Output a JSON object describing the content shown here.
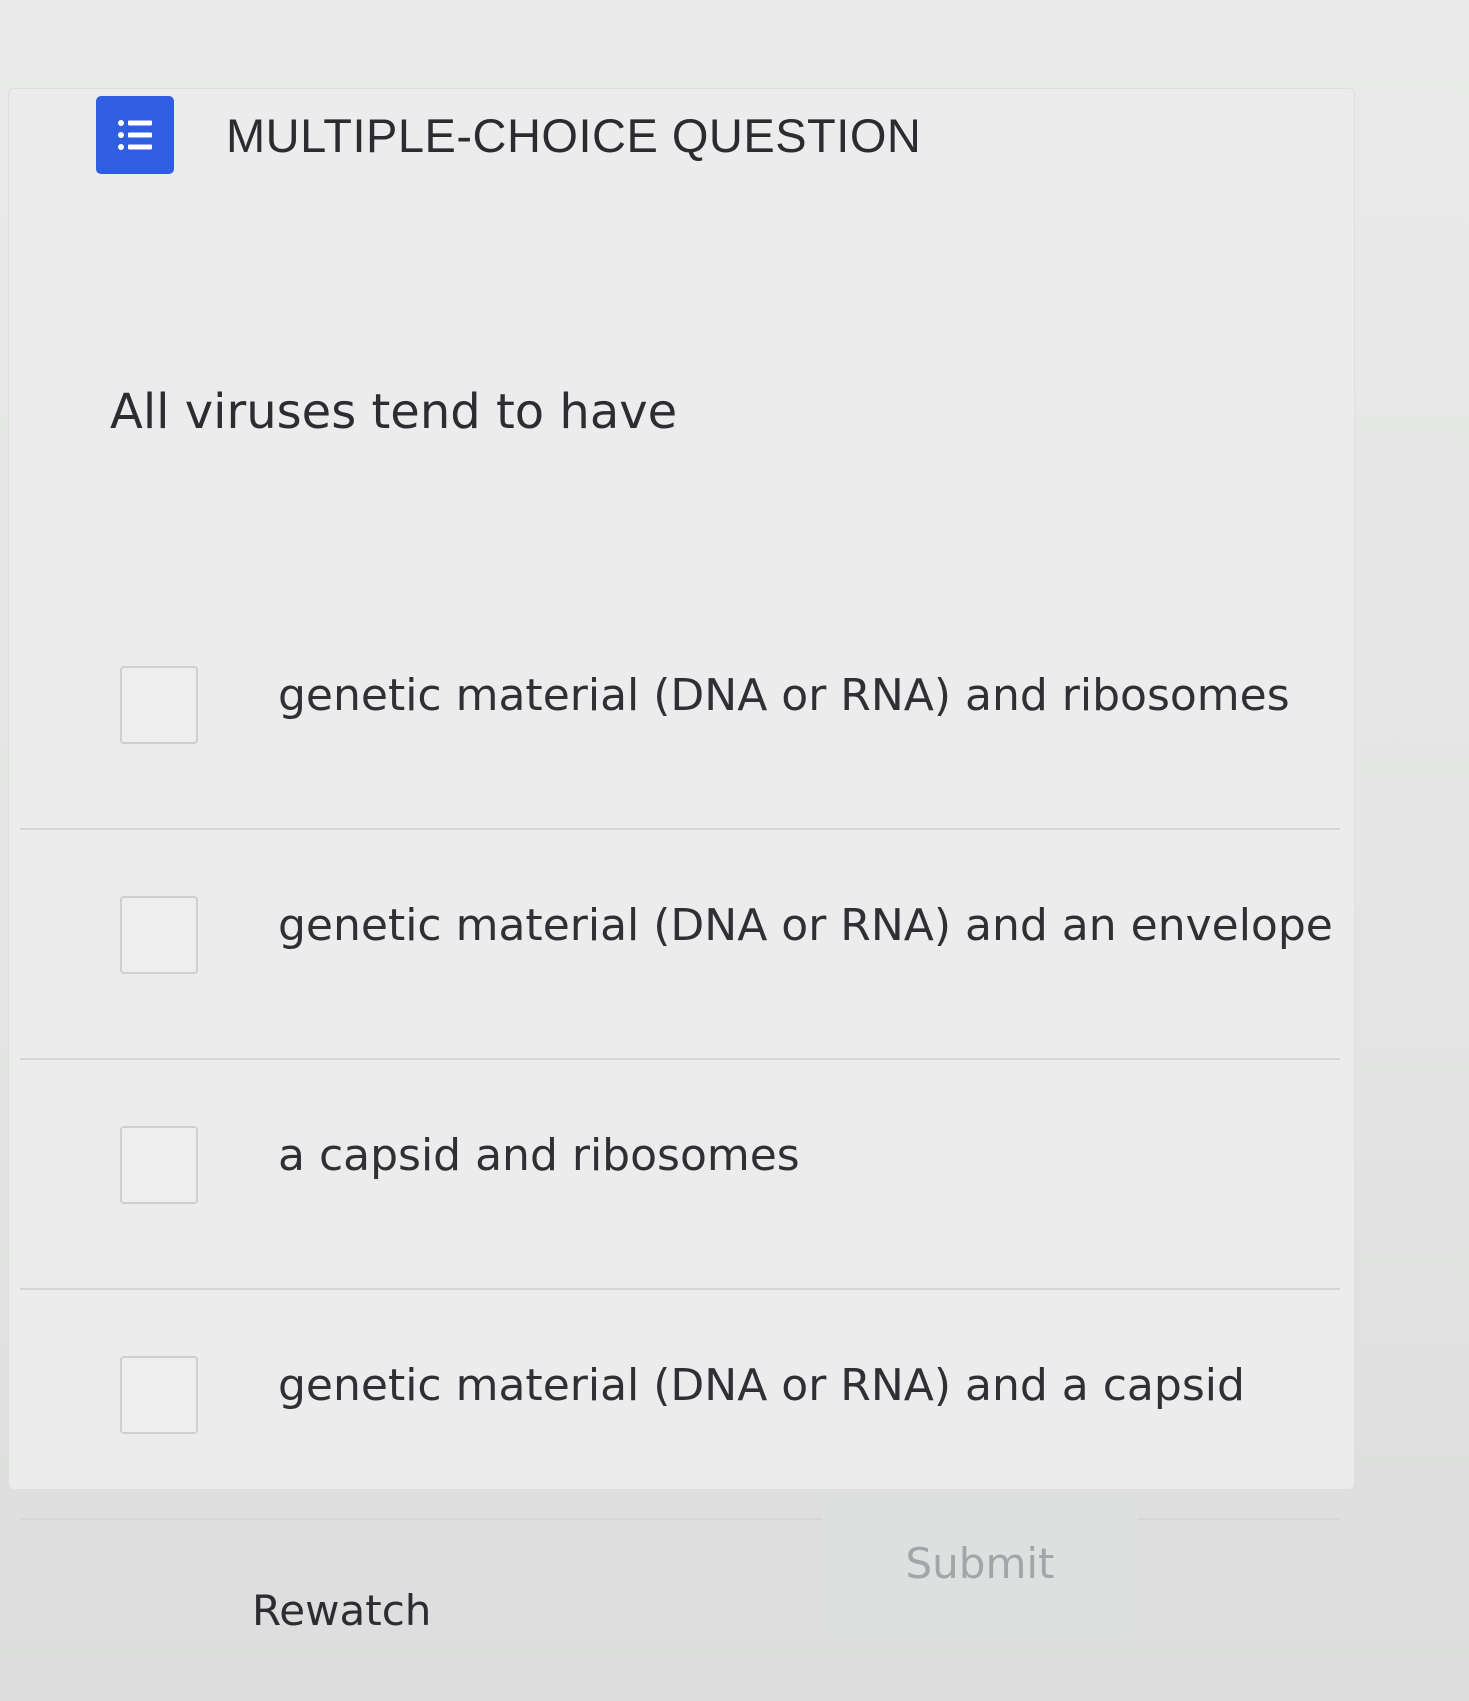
{
  "header": {
    "icon": "list-icon",
    "icon_color": "#2f5fe0",
    "title": "MULTIPLE-CHOICE QUESTION"
  },
  "question": {
    "text": "All viruses tend to have"
  },
  "options": [
    {
      "label": "genetic material (DNA or RNA) and ribosomes",
      "checked": false
    },
    {
      "label": "genetic material (DNA or RNA) and an envelope",
      "checked": false
    },
    {
      "label": "a capsid and ribosomes",
      "checked": false
    },
    {
      "label": "genetic material (DNA or RNA) and a capsid",
      "checked": false
    }
  ],
  "footer": {
    "rewatch_label": "Rewatch",
    "submit_label": "Submit",
    "submit_enabled": false
  }
}
